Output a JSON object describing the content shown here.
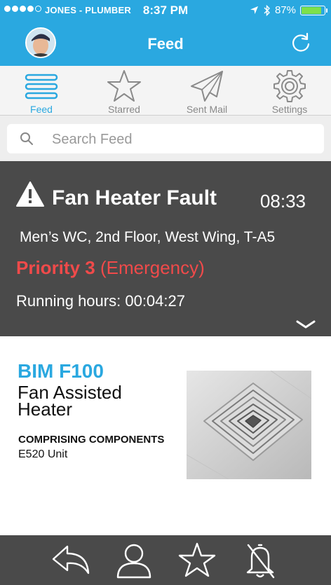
{
  "status_bar": {
    "carrier": "JONES - PLUMBER",
    "time": "8:37 PM",
    "battery_percent": "87%",
    "battery_level": 0.87,
    "signal_dots_filled": 4,
    "signal_dots_total": 5
  },
  "nav": {
    "title": "Feed",
    "avatar_icon": "user-avatar",
    "refresh_icon": "refresh-icon"
  },
  "tabs": [
    {
      "label": "Feed",
      "icon": "menu-lines-icon",
      "active": true
    },
    {
      "label": "Starred",
      "icon": "star-icon",
      "active": false
    },
    {
      "label": "Sent Mail",
      "icon": "paper-plane-icon",
      "active": false
    },
    {
      "label": "Settings",
      "icon": "gear-icon",
      "active": false
    }
  ],
  "search": {
    "placeholder": "Search Feed",
    "value": ""
  },
  "alert": {
    "title": "Fan Heater Fault",
    "time": "08:33",
    "location": "Men’s WC, 2nd Floor, West Wing, T-A5",
    "priority": "Priority 3",
    "priority_level": "(Emergency)",
    "running_hours_label": "Running hours:",
    "running_hours_value": "00:04:27"
  },
  "detail": {
    "code": "BIM F100",
    "name": "Fan Assisted Heater",
    "components_heading": "COMPRISING COMPONENTS",
    "components": [
      "E520 Unit"
    ],
    "image": "ceiling-air-vent-photo"
  },
  "bottom_bar": [
    {
      "icon": "reply-icon"
    },
    {
      "icon": "person-icon"
    },
    {
      "icon": "star-icon"
    },
    {
      "icon": "bell-off-icon"
    }
  ],
  "colors": {
    "accent": "#2aa8e0",
    "alert_bg": "#4a4a4a",
    "priority": "#f04a4a",
    "battery": "#7ee04a"
  }
}
